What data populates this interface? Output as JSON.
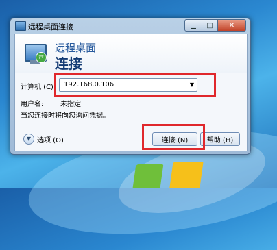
{
  "window": {
    "title": "远程桌面连接"
  },
  "banner": {
    "line1": "远程桌面",
    "line2": "连接"
  },
  "form": {
    "computer_label": "计算机 (C):",
    "computer_value": "192.168.0.106",
    "username_label": "用户名:",
    "username_value": "未指定",
    "hint": "当您连接时将向您询问凭据。"
  },
  "buttons": {
    "options": "选项 (O)",
    "connect": "连接 (N)",
    "help": "帮助 (H)"
  },
  "icons": {
    "options_chevron": "chevron-down-icon",
    "combo_arrow": "dropdown-arrow-icon",
    "app": "remote-desktop-icon"
  },
  "colors": {
    "highlight": "#e0282c"
  }
}
